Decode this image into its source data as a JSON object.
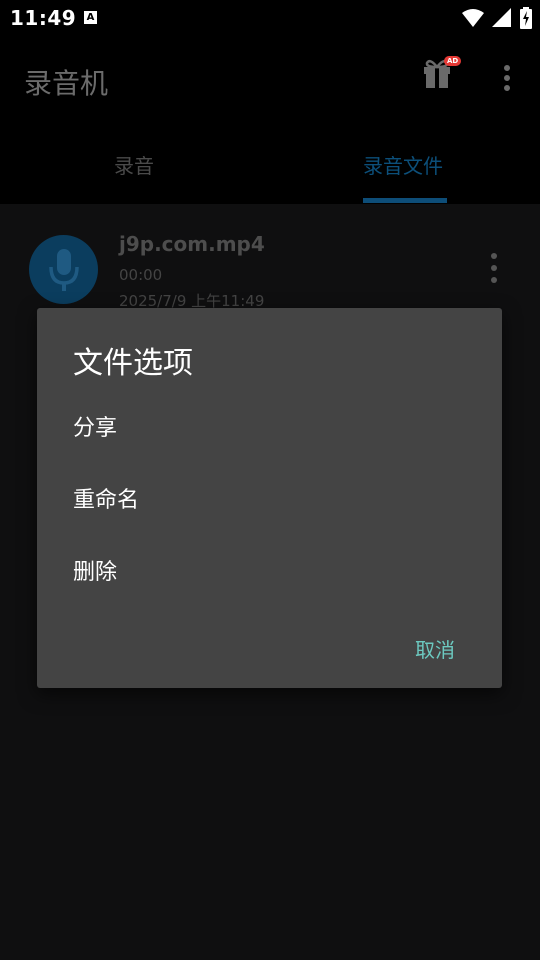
{
  "status_bar": {
    "time": "11:49",
    "notification_badge": "A",
    "icons": [
      "wifi-icon",
      "cell-signal-icon",
      "battery-charging-icon"
    ]
  },
  "app_bar": {
    "title": "录音机",
    "ad_badge": "AD",
    "icons": [
      "gift-icon",
      "more-vert-icon"
    ]
  },
  "tabs": [
    {
      "label": "录音",
      "selected": false
    },
    {
      "label": "录音文件",
      "selected": true
    }
  ],
  "recordings": [
    {
      "name": "j9p.com.mp4",
      "duration": "00:00",
      "date": "2025/7/9 上午11:49",
      "icon": "mic-icon"
    }
  ],
  "dialog": {
    "title": "文件选项",
    "options": [
      "分享",
      "重命名",
      "删除"
    ],
    "cancel": "取消"
  },
  "colors": {
    "accent": "#0d4d78",
    "dialog_bg": "#444444",
    "cancel_text": "#6cc9c0",
    "background": "#0f0f10"
  }
}
